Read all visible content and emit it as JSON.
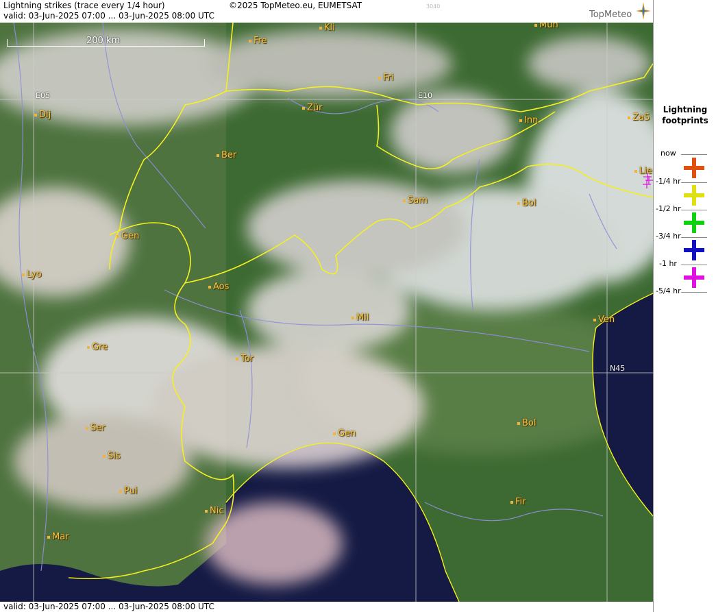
{
  "header": {
    "title": "Lightning strikes (trace every 1/4 hour)",
    "valid": "valid:  03-Jun-2025 07:00 ... 03-Jun-2025 08:00 UTC",
    "copyright": "©2025 TopMeteo.eu, EUMETSAT",
    "code": "3040",
    "logo": "TopMeteo"
  },
  "footer": {
    "valid": "valid:  03-Jun-2025 07:00 ... 03-Jun-2025 08:00 UTC"
  },
  "map": {
    "scale_label": "200 km",
    "grid_labels": {
      "e05": "E05",
      "e10": "E10",
      "n45": "N45"
    },
    "cities": [
      {
        "id": "kli",
        "name": "Kli"
      },
      {
        "id": "mun",
        "name": "Mun"
      },
      {
        "id": "fre",
        "name": "Fre"
      },
      {
        "id": "fri",
        "name": "Fri"
      },
      {
        "id": "dij",
        "name": "Dij"
      },
      {
        "id": "zur",
        "name": "Zür"
      },
      {
        "id": "inn",
        "name": "Inn"
      },
      {
        "id": "zas",
        "name": "ZaS"
      },
      {
        "id": "ber",
        "name": "Ber"
      },
      {
        "id": "lie",
        "name": "Lie"
      },
      {
        "id": "sam",
        "name": "Sam"
      },
      {
        "id": "bol1",
        "name": "Bol"
      },
      {
        "id": "gen1",
        "name": "Gen"
      },
      {
        "id": "lyo",
        "name": "Lyo"
      },
      {
        "id": "aos",
        "name": "Aos"
      },
      {
        "id": "mil",
        "name": "Mil"
      },
      {
        "id": "ven",
        "name": "Ven"
      },
      {
        "id": "gre",
        "name": "Gre"
      },
      {
        "id": "tor",
        "name": "Tor"
      },
      {
        "id": "ser",
        "name": "Ser"
      },
      {
        "id": "gen2",
        "name": "Gen"
      },
      {
        "id": "bol2",
        "name": "Bol"
      },
      {
        "id": "sis",
        "name": "Sis"
      },
      {
        "id": "pui",
        "name": "Pui"
      },
      {
        "id": "nic",
        "name": "Nic"
      },
      {
        "id": "fir",
        "name": "Fir"
      },
      {
        "id": "mar",
        "name": "Mar"
      }
    ],
    "colors": {
      "border": "#f5f020",
      "river": "#8f8fdc",
      "city": "#f0c24a",
      "sea": "#141a44",
      "land": "#3d6a32",
      "cloud": "#e8e2e2"
    }
  },
  "legend": {
    "title": "Lightning footprints",
    "rows": [
      {
        "label": "now",
        "color": null
      },
      {
        "label": "-1/4 hr",
        "color": "#e05010"
      },
      {
        "label": "-1/2 hr",
        "color": "#e0e010"
      },
      {
        "label": "-3/4 hr",
        "color": "#10d010"
      },
      {
        "label": "-1 hr",
        "color": "#1010c0"
      },
      {
        "label": "-5/4 hr",
        "color": "#e010e0"
      }
    ]
  }
}
